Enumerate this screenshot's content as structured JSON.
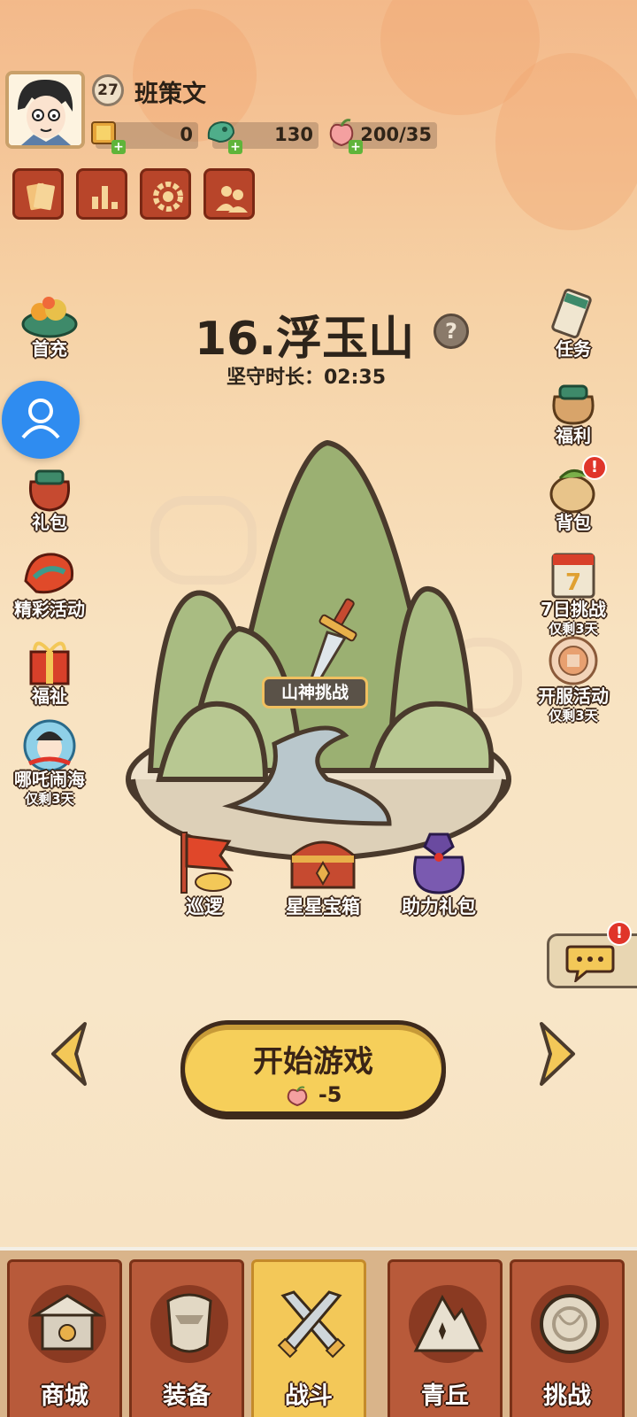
{
  "player": {
    "level": "27",
    "name": "班策文",
    "resources": [
      {
        "icon": "gold-ticket-icon",
        "value": "0"
      },
      {
        "icon": "jade-dragon-icon",
        "value": "130"
      },
      {
        "icon": "peach-stamina-icon",
        "value": "200/35"
      }
    ]
  },
  "top_buttons": [
    "card-icon",
    "ranking-icon",
    "settings-icon",
    "friends-icon"
  ],
  "left_menu": [
    {
      "label": "首充",
      "icon": "treasure-bowl-icon"
    },
    {
      "label": "礼包",
      "icon": "gift-bag-icon"
    },
    {
      "label": "精彩活动",
      "icon": "dragon-event-icon"
    },
    {
      "label": "福祉",
      "icon": "gift-box-icon"
    },
    {
      "label": "哪吒闹海",
      "sub": "仅剩3天",
      "icon": "nezha-icon"
    }
  ],
  "right_menu": [
    {
      "label": "任务",
      "icon": "scroll-icon"
    },
    {
      "label": "福利",
      "icon": "lucky-bag-icon"
    },
    {
      "label": "背包",
      "icon": "backpack-icon",
      "alert": "!"
    },
    {
      "label": "7日挑战",
      "sub": "仅剩3天",
      "icon": "seven-day-icon"
    },
    {
      "label": "开服活动",
      "sub": "仅剩3天",
      "icon": "server-event-icon"
    }
  ],
  "stage": {
    "title": "16.浮玉山",
    "help": "?",
    "timer": "坚守时长：02:35",
    "challenge_label": "山神挑战"
  },
  "stage_buttons": [
    {
      "label": "巡逻",
      "icon": "patrol-flag-icon"
    },
    {
      "label": "星星宝箱",
      "icon": "star-chest-icon"
    },
    {
      "label": "助力礼包",
      "icon": "assist-pouch-icon"
    }
  ],
  "chat": {
    "alert": "!"
  },
  "start": {
    "label": "开始游戏",
    "cost": "-5"
  },
  "bottom_nav": [
    {
      "label": "商城",
      "icon": "shop-icon",
      "active": false
    },
    {
      "label": "装备",
      "icon": "armor-icon",
      "active": false
    },
    {
      "label": "战斗",
      "icon": "crossed-swords-icon",
      "active": true
    },
    {
      "label": "青丘",
      "icon": "mountain-shrine-icon",
      "active": false
    },
    {
      "label": "挑战",
      "icon": "challenge-gong-icon",
      "active": false
    }
  ],
  "colors": {
    "accent_yellow": "#f3c858",
    "button_red": "#b8452a",
    "mountain_green": "#9bb072",
    "water_blue": "#b9c7cc",
    "alert_red": "#e0352a",
    "float_blue": "#2f8cf0"
  }
}
